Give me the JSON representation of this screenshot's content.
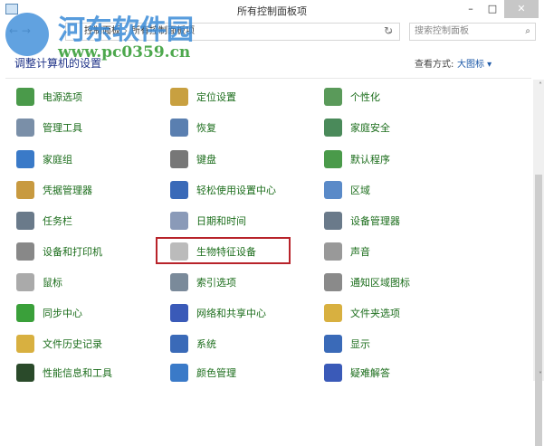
{
  "window": {
    "title": "所有控制面板项",
    "minimize": "–",
    "maximize": "□",
    "close": "✕"
  },
  "address": {
    "crumbs": [
      "控制面板",
      "所有控制面板项"
    ],
    "separator": "›",
    "dropdown": "⌄",
    "refresh": "↻"
  },
  "search": {
    "placeholder": "搜索控制面板",
    "icon": "⌕"
  },
  "nav": {
    "back": "←",
    "forward": "→"
  },
  "heading": "调整计算机的设置",
  "view": {
    "label": "查看方式:",
    "value": "大图标 ▾"
  },
  "watermark": {
    "name": "河东软件园",
    "url": "www.pc0359.cn"
  },
  "items": [
    {
      "label": "电源选项",
      "color": "#4a9a4a"
    },
    {
      "label": "定位设置",
      "color": "#c8a040"
    },
    {
      "label": "个性化",
      "color": "#5a9a5a"
    },
    {
      "label": "管理工具",
      "color": "#7a8fa8"
    },
    {
      "label": "恢复",
      "color": "#5a7fb0"
    },
    {
      "label": "家庭安全",
      "color": "#4a8a5a"
    },
    {
      "label": "家庭组",
      "color": "#3a7ac8"
    },
    {
      "label": "键盘",
      "color": "#777777"
    },
    {
      "label": "默认程序",
      "color": "#4a9a4a"
    },
    {
      "label": "凭据管理器",
      "color": "#c89a40"
    },
    {
      "label": "轻松使用设置中心",
      "color": "#3a6ab8"
    },
    {
      "label": "区域",
      "color": "#5a8ac8"
    },
    {
      "label": "任务栏",
      "color": "#6a7a8a"
    },
    {
      "label": "日期和时间",
      "color": "#8a9ab8"
    },
    {
      "label": "设备管理器",
      "color": "#6a7a8a"
    },
    {
      "label": "设备和打印机",
      "color": "#888888"
    },
    {
      "label": "生物特征设备",
      "color": "#bbbbbb"
    },
    {
      "label": "声音",
      "color": "#999999"
    },
    {
      "label": "鼠标",
      "color": "#aaaaaa"
    },
    {
      "label": "索引选项",
      "color": "#7a8a9a"
    },
    {
      "label": "通知区域图标",
      "color": "#8a8a8a"
    },
    {
      "label": "同步中心",
      "color": "#3aa03a"
    },
    {
      "label": "网络和共享中心",
      "color": "#3a5ab8"
    },
    {
      "label": "文件夹选项",
      "color": "#d8b040"
    },
    {
      "label": "文件历史记录",
      "color": "#d8b040"
    },
    {
      "label": "系统",
      "color": "#3a6ab8"
    },
    {
      "label": "显示",
      "color": "#3a6ab8"
    },
    {
      "label": "性能信息和工具",
      "color": "#2a4a2a"
    },
    {
      "label": "颜色管理",
      "color": "#3a7ac8"
    },
    {
      "label": "疑难解答",
      "color": "#3a5ab8"
    }
  ],
  "highlighted": "生物特征设备"
}
